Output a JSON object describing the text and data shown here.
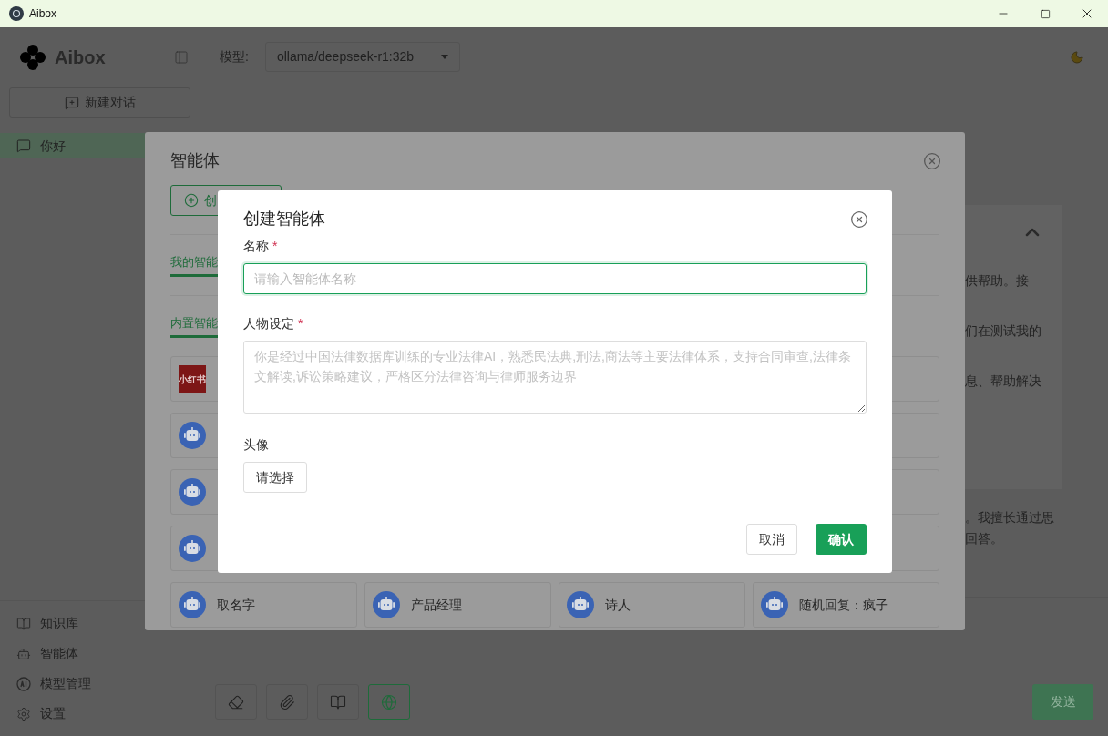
{
  "window": {
    "title": "Aibox"
  },
  "sidebar": {
    "logo": "Aibox",
    "new_chat": "新建对话",
    "conversations": [
      {
        "label": "你好",
        "selected": true
      }
    ],
    "nav": [
      {
        "kind": "book",
        "label": "知识库"
      },
      {
        "kind": "bot",
        "label": "智能体"
      },
      {
        "kind": "ai",
        "label": "模型管理"
      },
      {
        "kind": "settings",
        "label": "设置"
      }
    ]
  },
  "header": {
    "model_label": "模型:",
    "model": "ollama/deepseek-r1:32b"
  },
  "chat": {
    "message_lines": [
      "供帮助。接",
      "们在测试我的",
      "息、帮助解决"
    ],
    "reply_lines": [
      "。我擅长通过思",
      "回答。"
    ]
  },
  "toolbar": {
    "tools": [
      {
        "kind": "eraser",
        "selected": false
      },
      {
        "kind": "paperclip",
        "selected": false
      },
      {
        "kind": "book",
        "selected": false
      },
      {
        "kind": "globe",
        "selected": true
      }
    ],
    "send": "发送"
  },
  "agents_dialog": {
    "title": "智能体",
    "create_button": "创",
    "sections": [
      {
        "label": "我的智能"
      },
      {
        "label": "内置智能"
      }
    ],
    "card_rows": [
      {
        "cards": [
          {
            "kind": "logo",
            "logo_text": "小红书"
          },
          {
            "kind": "blank"
          }
        ]
      },
      {
        "cards": [
          {
            "kind": "robot"
          },
          {
            "kind": "blank"
          }
        ]
      },
      {
        "cards": [
          {
            "kind": "robot"
          },
          {
            "kind": "blank"
          }
        ]
      },
      {
        "cards": [
          {
            "kind": "robot"
          },
          {
            "kind": "blank"
          }
        ]
      },
      {
        "cards": [
          {
            "kind": "robot",
            "name": "取名字"
          },
          {
            "kind": "robot",
            "name": "产品经理"
          },
          {
            "kind": "robot",
            "name": "诗人"
          },
          {
            "kind": "robot",
            "name": "随机回复：疯子"
          }
        ]
      }
    ]
  },
  "create_dialog": {
    "title": "创建智能体",
    "name_label": "名称",
    "name_placeholder": "请输入智能体名称",
    "persona_label": "人物设定",
    "persona_placeholder": "你是经过中国法律数据库训练的专业法律AI，熟悉民法典,刑法,商法等主要法律体系，支持合同审查,法律条文解读,诉讼策略建议，严格区分法律咨询与律师服务边界",
    "required_mark": "*",
    "avatar_label": "头像",
    "avatar_button": "请选择",
    "cancel": "取消",
    "confirm": "确认"
  }
}
